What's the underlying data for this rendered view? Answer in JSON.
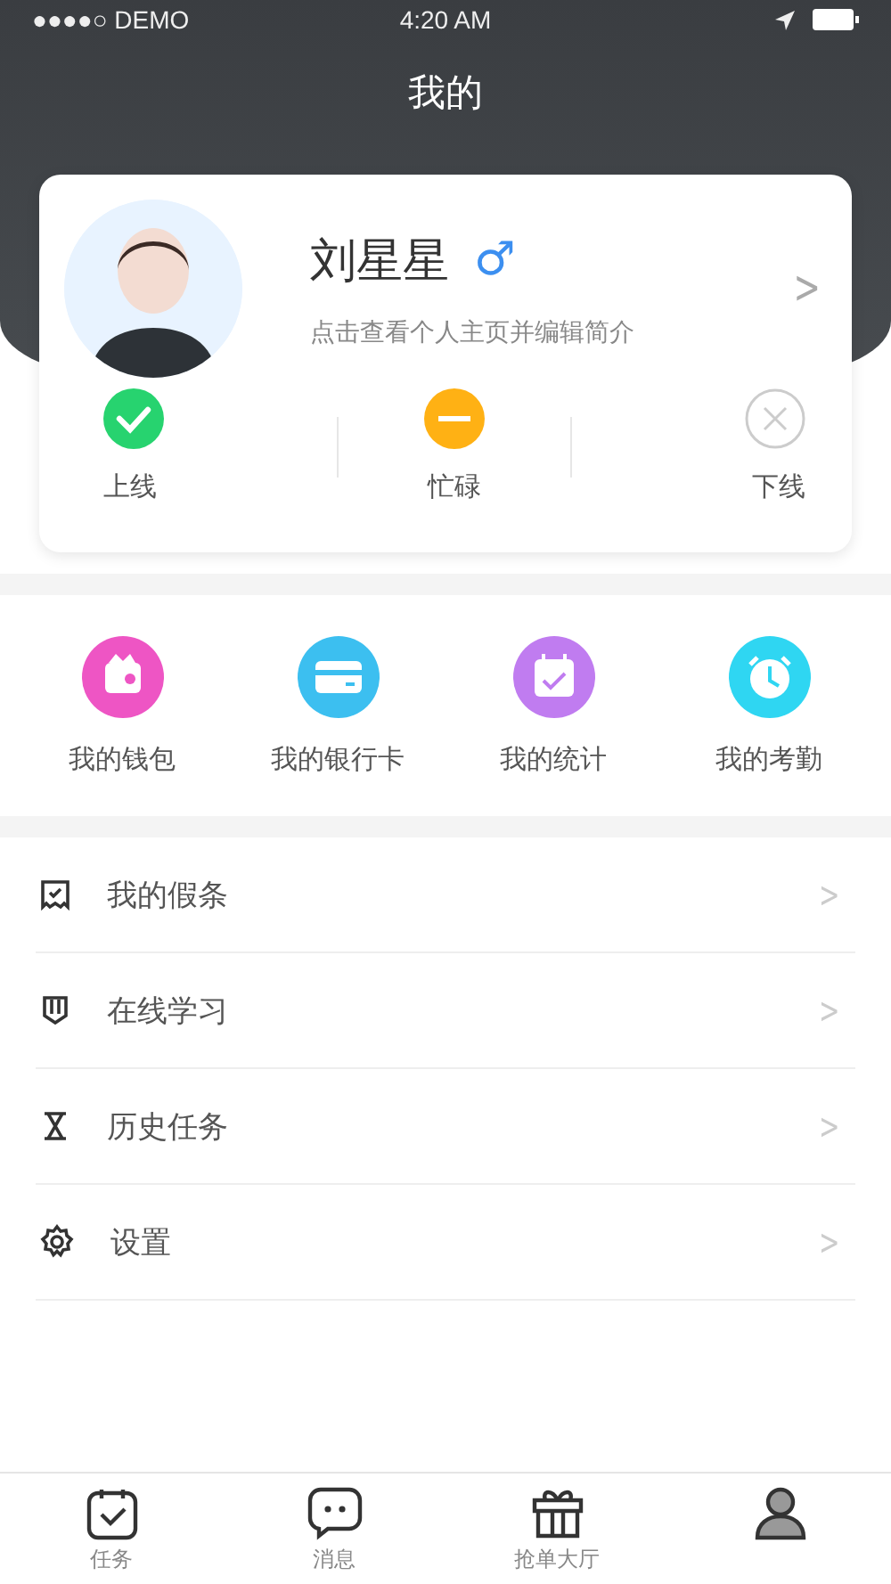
{
  "status_bar": {
    "carrier": "●●●●○ DEMO",
    "time": "4:20 AM"
  },
  "header": {
    "title": "我的"
  },
  "profile": {
    "name": "刘星星",
    "gender": "♂",
    "subtitle": "点击查看个人主页并编辑简介",
    "chevron": ">"
  },
  "statuses": [
    {
      "kind": "online",
      "label": "上线"
    },
    {
      "kind": "busy",
      "label": "忙碌"
    },
    {
      "kind": "offline",
      "label": "下线"
    }
  ],
  "shortcuts": [
    {
      "kind": "wallet",
      "label": "我的钱包",
      "color": "#ee55c4"
    },
    {
      "kind": "card",
      "label": "我的银行卡",
      "color": "#3cbff0"
    },
    {
      "kind": "calendar",
      "label": "我的统计",
      "color": "#c07cf0"
    },
    {
      "kind": "clock",
      "label": "我的考勤",
      "color": "#2fd6f2"
    }
  ],
  "menu": [
    {
      "kind": "receipt",
      "label": "我的假条",
      "chevron": ">"
    },
    {
      "kind": "shield",
      "label": "在线学习",
      "chevron": ">"
    },
    {
      "kind": "hourglass",
      "label": "历史任务",
      "chevron": ">"
    },
    {
      "kind": "gear",
      "label": "设置",
      "chevron": ">"
    }
  ],
  "tab_bar": [
    {
      "kind": "task",
      "label": "任务",
      "selected": false
    },
    {
      "kind": "chat",
      "label": "消息",
      "selected": false
    },
    {
      "kind": "gift",
      "label": "抢单大厅",
      "selected": false
    },
    {
      "kind": "user",
      "selected": true
    }
  ]
}
